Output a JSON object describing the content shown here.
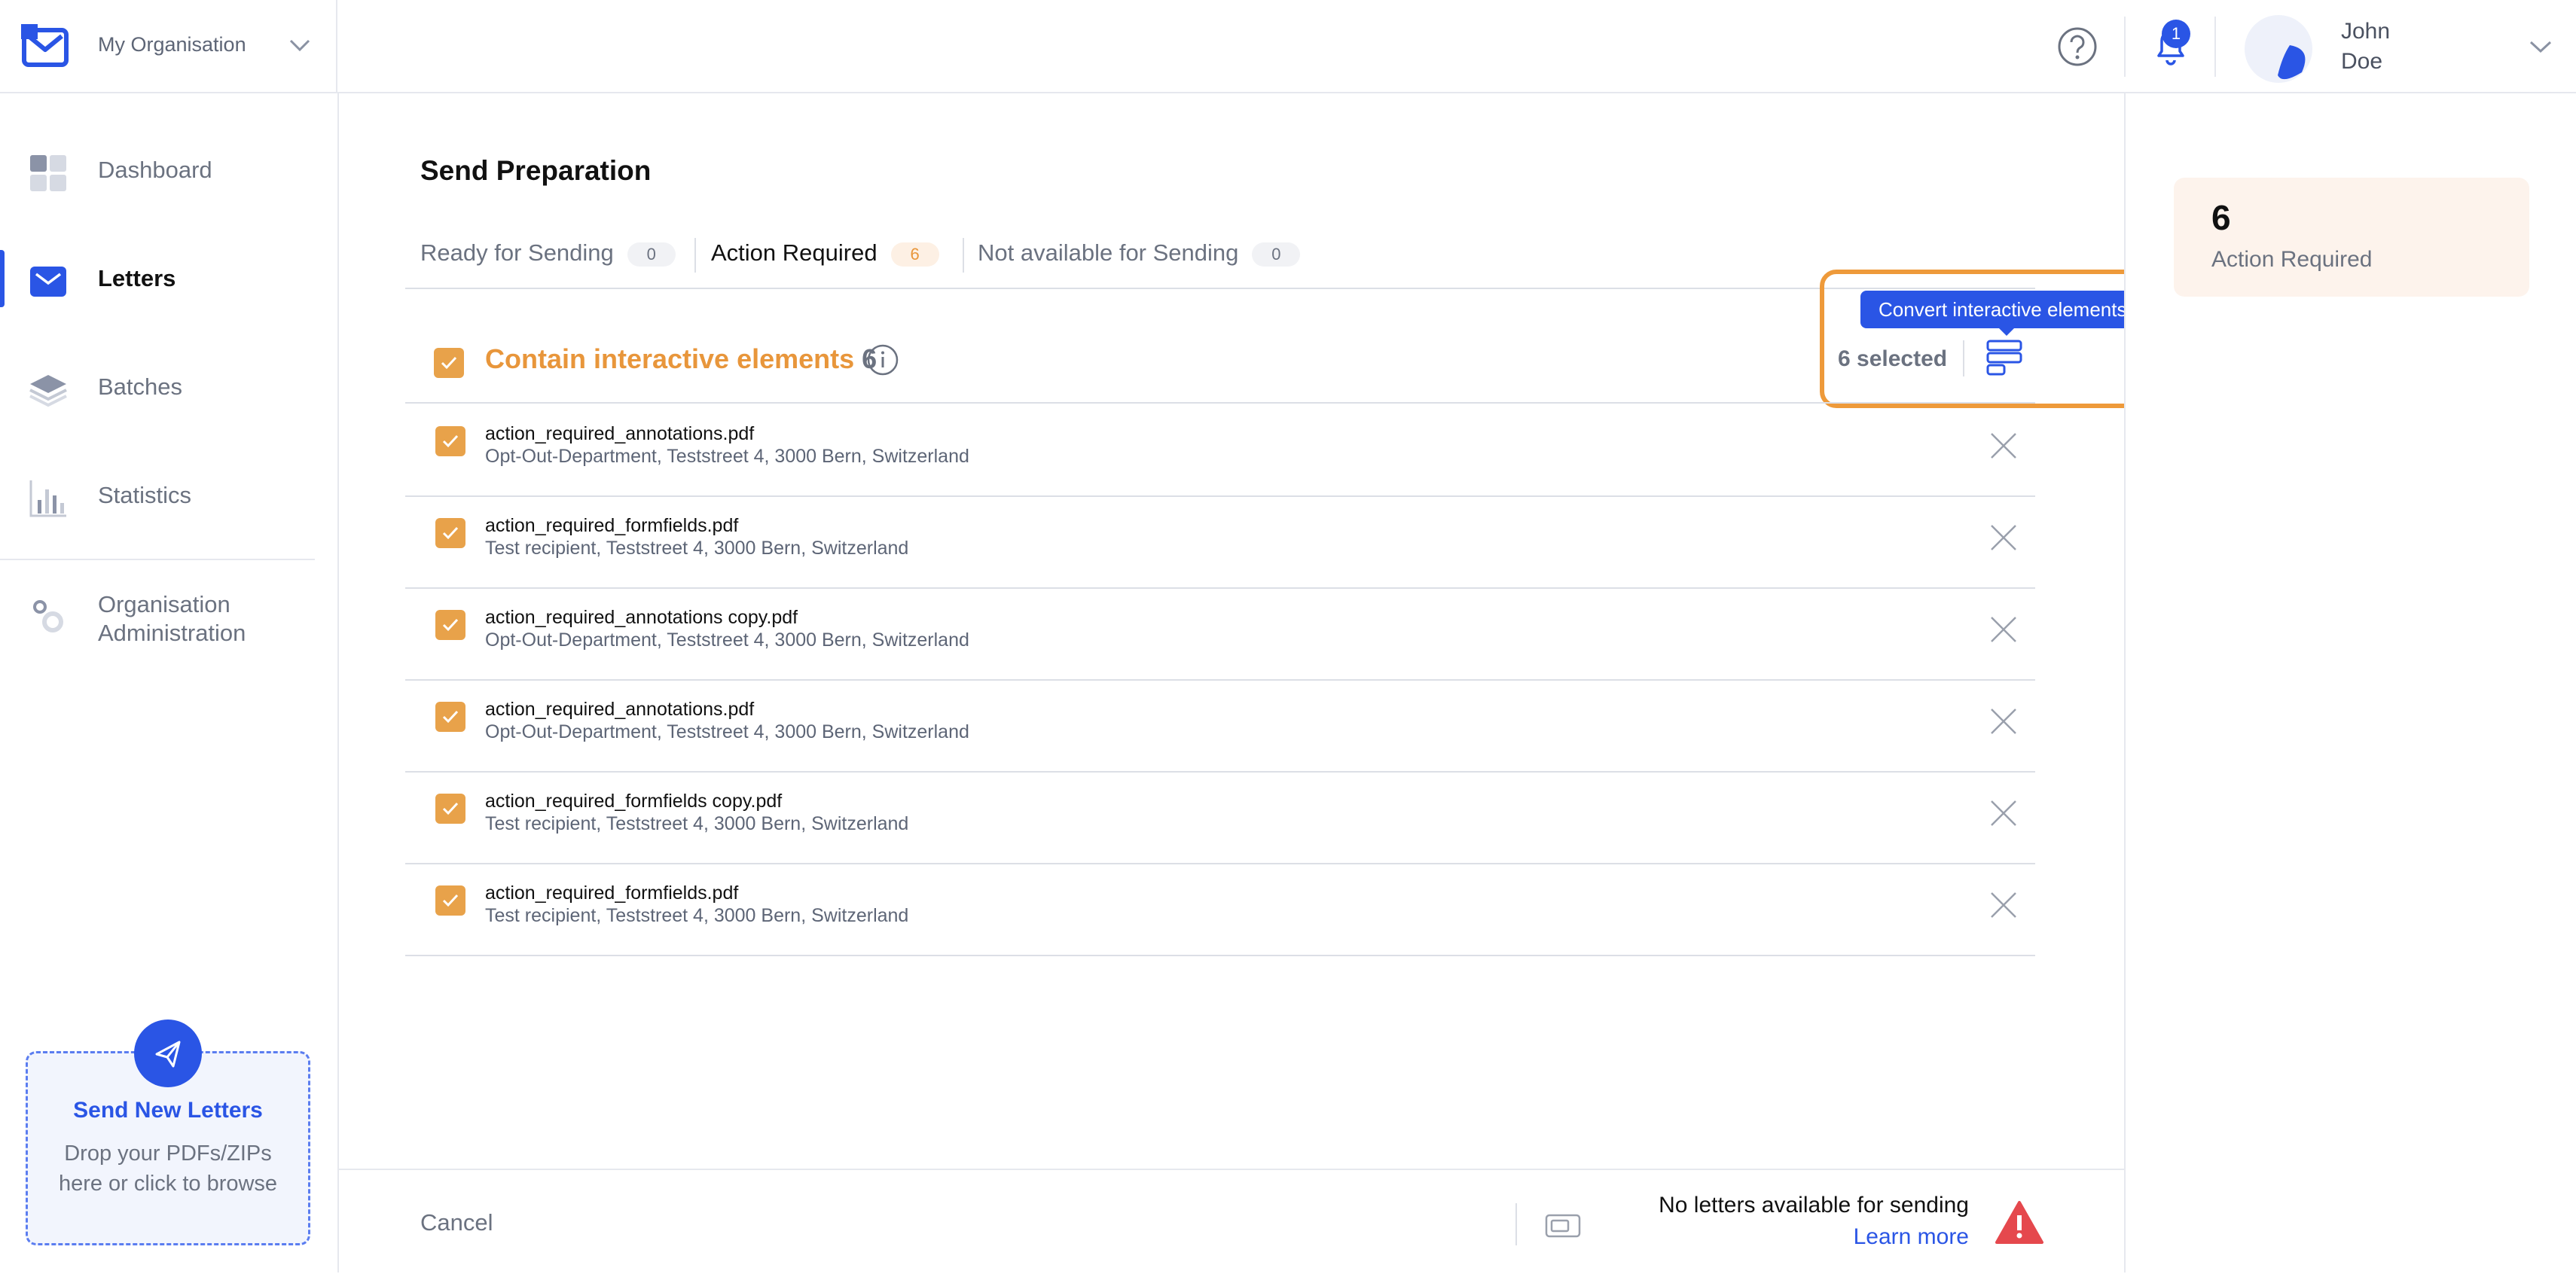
{
  "header": {
    "org_name": "My Organisation",
    "notification_count": "1",
    "user": {
      "first_name": "John",
      "last_name": "Doe"
    }
  },
  "sidebar": {
    "items": [
      {
        "label": "Dashboard",
        "icon": "dashboard-icon"
      },
      {
        "label": "Letters",
        "icon": "envelope-icon",
        "active": true
      },
      {
        "label": "Batches",
        "icon": "layers-icon"
      },
      {
        "label": "Statistics",
        "icon": "bar-chart-icon"
      },
      {
        "label": "Organisation Administration",
        "icon": "gear-icon"
      }
    ],
    "drop_zone": {
      "title": "Send New Letters",
      "subtitle_line1": "Drop your PDFs/ZIPs",
      "subtitle_line2": "here or click to browse"
    }
  },
  "main": {
    "title": "Send Preparation",
    "tabs": [
      {
        "label": "Ready for Sending",
        "count": "0"
      },
      {
        "label": "Action Required",
        "count": "6",
        "active": true
      },
      {
        "label": "Not available for Sending",
        "count": "0"
      }
    ],
    "group": {
      "title": "Contain interactive elements",
      "count": "6",
      "selected_text": "6 selected",
      "tooltip": "Convert interactive elements"
    },
    "rows": [
      {
        "file": "action_required_annotations.pdf",
        "recipient": "Opt-Out-Department, Teststreet 4, 3000 Bern, Switzerland"
      },
      {
        "file": "action_required_formfields.pdf",
        "recipient": "Test recipient, Teststreet 4, 3000 Bern, Switzerland"
      },
      {
        "file": "action_required_annotations copy.pdf",
        "recipient": "Opt-Out-Department, Teststreet 4, 3000 Bern, Switzerland"
      },
      {
        "file": "action_required_annotations.pdf",
        "recipient": "Opt-Out-Department, Teststreet 4, 3000 Bern, Switzerland"
      },
      {
        "file": "action_required_formfields copy.pdf",
        "recipient": "Test recipient, Teststreet 4, 3000 Bern, Switzerland"
      },
      {
        "file": "action_required_formfields.pdf",
        "recipient": "Test recipient, Teststreet 4, 3000 Bern, Switzerland"
      }
    ],
    "footer": {
      "cancel": "Cancel",
      "status": "No letters available for sending",
      "learn_more": "Learn more"
    }
  },
  "summary": {
    "count": "6",
    "label": "Action Required"
  },
  "colors": {
    "accent": "#2a55e5",
    "warning": "#e8963b",
    "highlight": "#ee9a3a",
    "danger": "#e5484d"
  }
}
